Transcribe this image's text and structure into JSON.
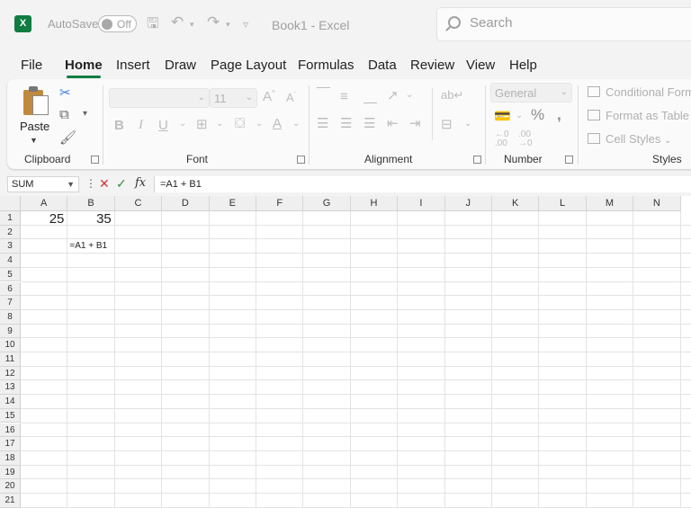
{
  "titlebar": {
    "app_icon": "excel-logo-icon",
    "app_icon_letter": "X",
    "autosave_label": "AutoSave",
    "autosave_state": "Off",
    "doc_title": "Book1  -  Excel",
    "search_placeholder": "Search"
  },
  "menu": [
    "File",
    "Home",
    "Insert",
    "Draw",
    "Page Layout",
    "Formulas",
    "Data",
    "Review",
    "View",
    "Help"
  ],
  "menu_active": "Home",
  "ribbon": {
    "clipboard": {
      "paste_label": "Paste",
      "group_label": "Clipboard"
    },
    "font": {
      "font_name": "",
      "font_size": "11",
      "group_label": "Font"
    },
    "alignment": {
      "group_label": "Alignment"
    },
    "number": {
      "format": "General",
      "group_label": "Number"
    },
    "styles": {
      "conditional": "Conditional Formatting",
      "format_table": "Format as Table",
      "cell_styles": "Cell Styles",
      "group_label": "Styles"
    }
  },
  "formula_bar": {
    "name_box": "SUM",
    "formula": "=A1 + B1"
  },
  "sheet": {
    "columns": [
      "A",
      "B",
      "C",
      "D",
      "E",
      "F",
      "G",
      "H",
      "I",
      "J",
      "K",
      "L",
      "M",
      "N"
    ],
    "rows": [
      "1",
      "2",
      "3",
      "4",
      "5",
      "6",
      "7",
      "8",
      "9",
      "10",
      "11",
      "12",
      "13",
      "14",
      "15",
      "16",
      "17",
      "18",
      "19",
      "20",
      "21"
    ],
    "cells": {
      "A1": "25",
      "B1": "35",
      "B3": "=A1 + B1"
    }
  },
  "colors": {
    "accent": "#107c41",
    "cancel": "#d13438",
    "enter": "#3c8c3c"
  }
}
